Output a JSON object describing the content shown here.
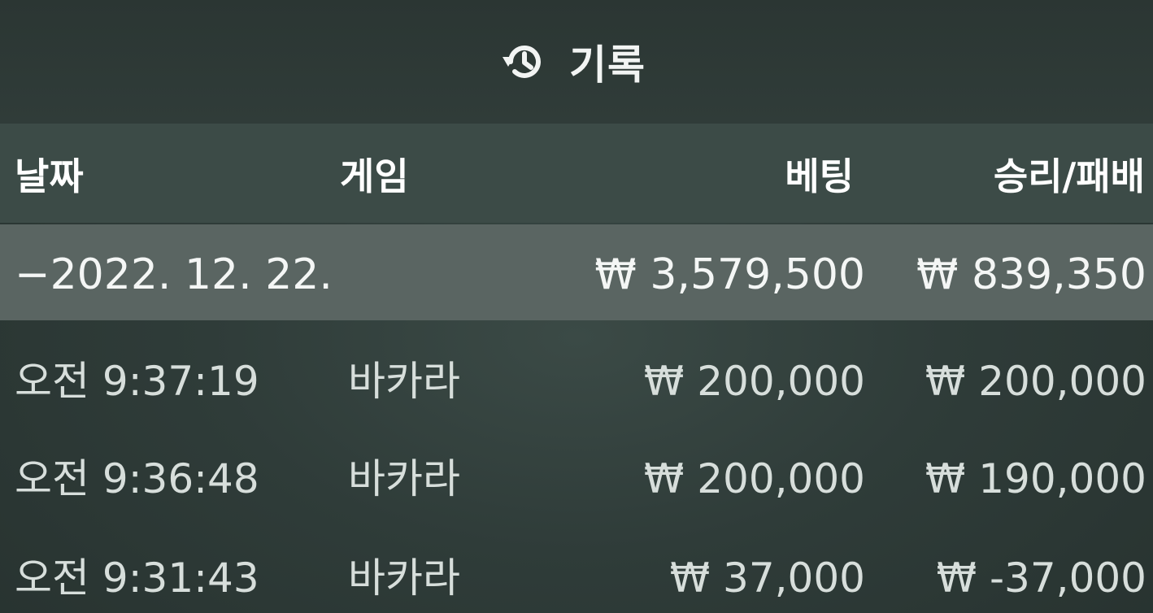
{
  "header": {
    "title": "기록",
    "icon": "history-icon"
  },
  "columns": {
    "date": "날짜",
    "game": "게임",
    "bet": "베팅",
    "result": "승리/패배"
  },
  "summary": {
    "date": "−2022. 12. 22.",
    "bet": "₩ 3,579,500",
    "result": "₩ 839,350"
  },
  "rows": [
    {
      "time": "오전 9:37:19",
      "game": "바카라",
      "bet": "₩ 200,000",
      "result": "₩ 200,000"
    },
    {
      "time": "오전 9:36:48",
      "game": "바카라",
      "bet": "₩ 200,000",
      "result": "₩ 190,000"
    },
    {
      "time": "오전 9:31:43",
      "game": "바카라",
      "bet": "₩ 37,000",
      "result": "₩ -37,000"
    }
  ],
  "colors": {
    "background": "#2f3c39",
    "header_row": "#3c4b47",
    "summary_row": "#5a6562",
    "text": "#e8ecea"
  }
}
